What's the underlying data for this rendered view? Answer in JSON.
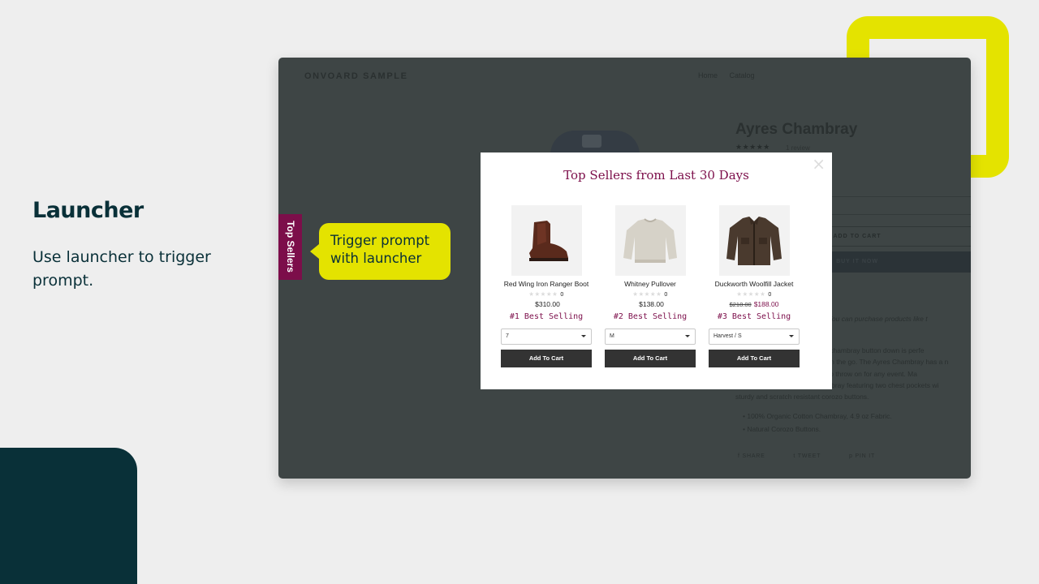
{
  "slide": {
    "title": "Launcher",
    "description": "Use launcher to trigger prompt."
  },
  "colors": {
    "accent_yellow": "#e4e300",
    "dark_teal": "#093038",
    "brand_maroon": "#7c0e4a"
  },
  "store": {
    "name": "ONVOARD SAMPLE",
    "nav": [
      "Home",
      "Catalog"
    ],
    "product_title": "Ayres Chambray",
    "rating_stars": "★★★★★",
    "reviews_text": "1 review",
    "add_to_cart_label": "ADD TO CART",
    "buy_now_label": "BUY IT NOW",
    "description_lines": [
      "This is a demonstration store. You can purchase products like t",
      "Comfortable and practical, our chambray button down is perfe",
      "travelling or bumming around on the go. The Ayres Chambray has a n",
      "fit, making it perfectly suitable to throw on for any event. Ma",
      "from a washed out indigo chambray featuring two chest pockets wi",
      "sturdy and scratch resistant corozo buttons."
    ],
    "bullets": [
      "100% Organic Cotton Chambray, 4.9 oz Fabric.",
      "Natural Corozo Buttons."
    ],
    "share_labels": [
      "SHARE",
      "TWEET",
      "PIN IT"
    ]
  },
  "launcher": {
    "label": "Top Sellers"
  },
  "callout": {
    "line1": "Trigger prompt",
    "line2": "with launcher"
  },
  "modal": {
    "close_symbol": "×",
    "title": "Top Sellers from Last 30 Days",
    "products": [
      {
        "name": "Red Wing Iron Ranger Boot",
        "stars": "★★★★★",
        "rating_count": "0",
        "old_price": "",
        "price": "$310.00",
        "rank": "#1 Best Selling",
        "option": "7",
        "button": "Add To Cart",
        "image_icon": "boot-icon"
      },
      {
        "name": "Whitney Pullover",
        "stars": "★★★★★",
        "rating_count": "0",
        "old_price": "",
        "price": "$138.00",
        "rank": "#2 Best Selling",
        "option": "M",
        "button": "Add To Cart",
        "image_icon": "sweater-icon"
      },
      {
        "name": "Duckworth Woolfill Jacket",
        "stars": "★★★★★",
        "rating_count": "0",
        "old_price": "$218.00",
        "price": "$188.00",
        "rank": "#3 Best Selling",
        "option": "Harvest / S",
        "button": "Add To Cart",
        "image_icon": "jacket-icon"
      }
    ]
  }
}
